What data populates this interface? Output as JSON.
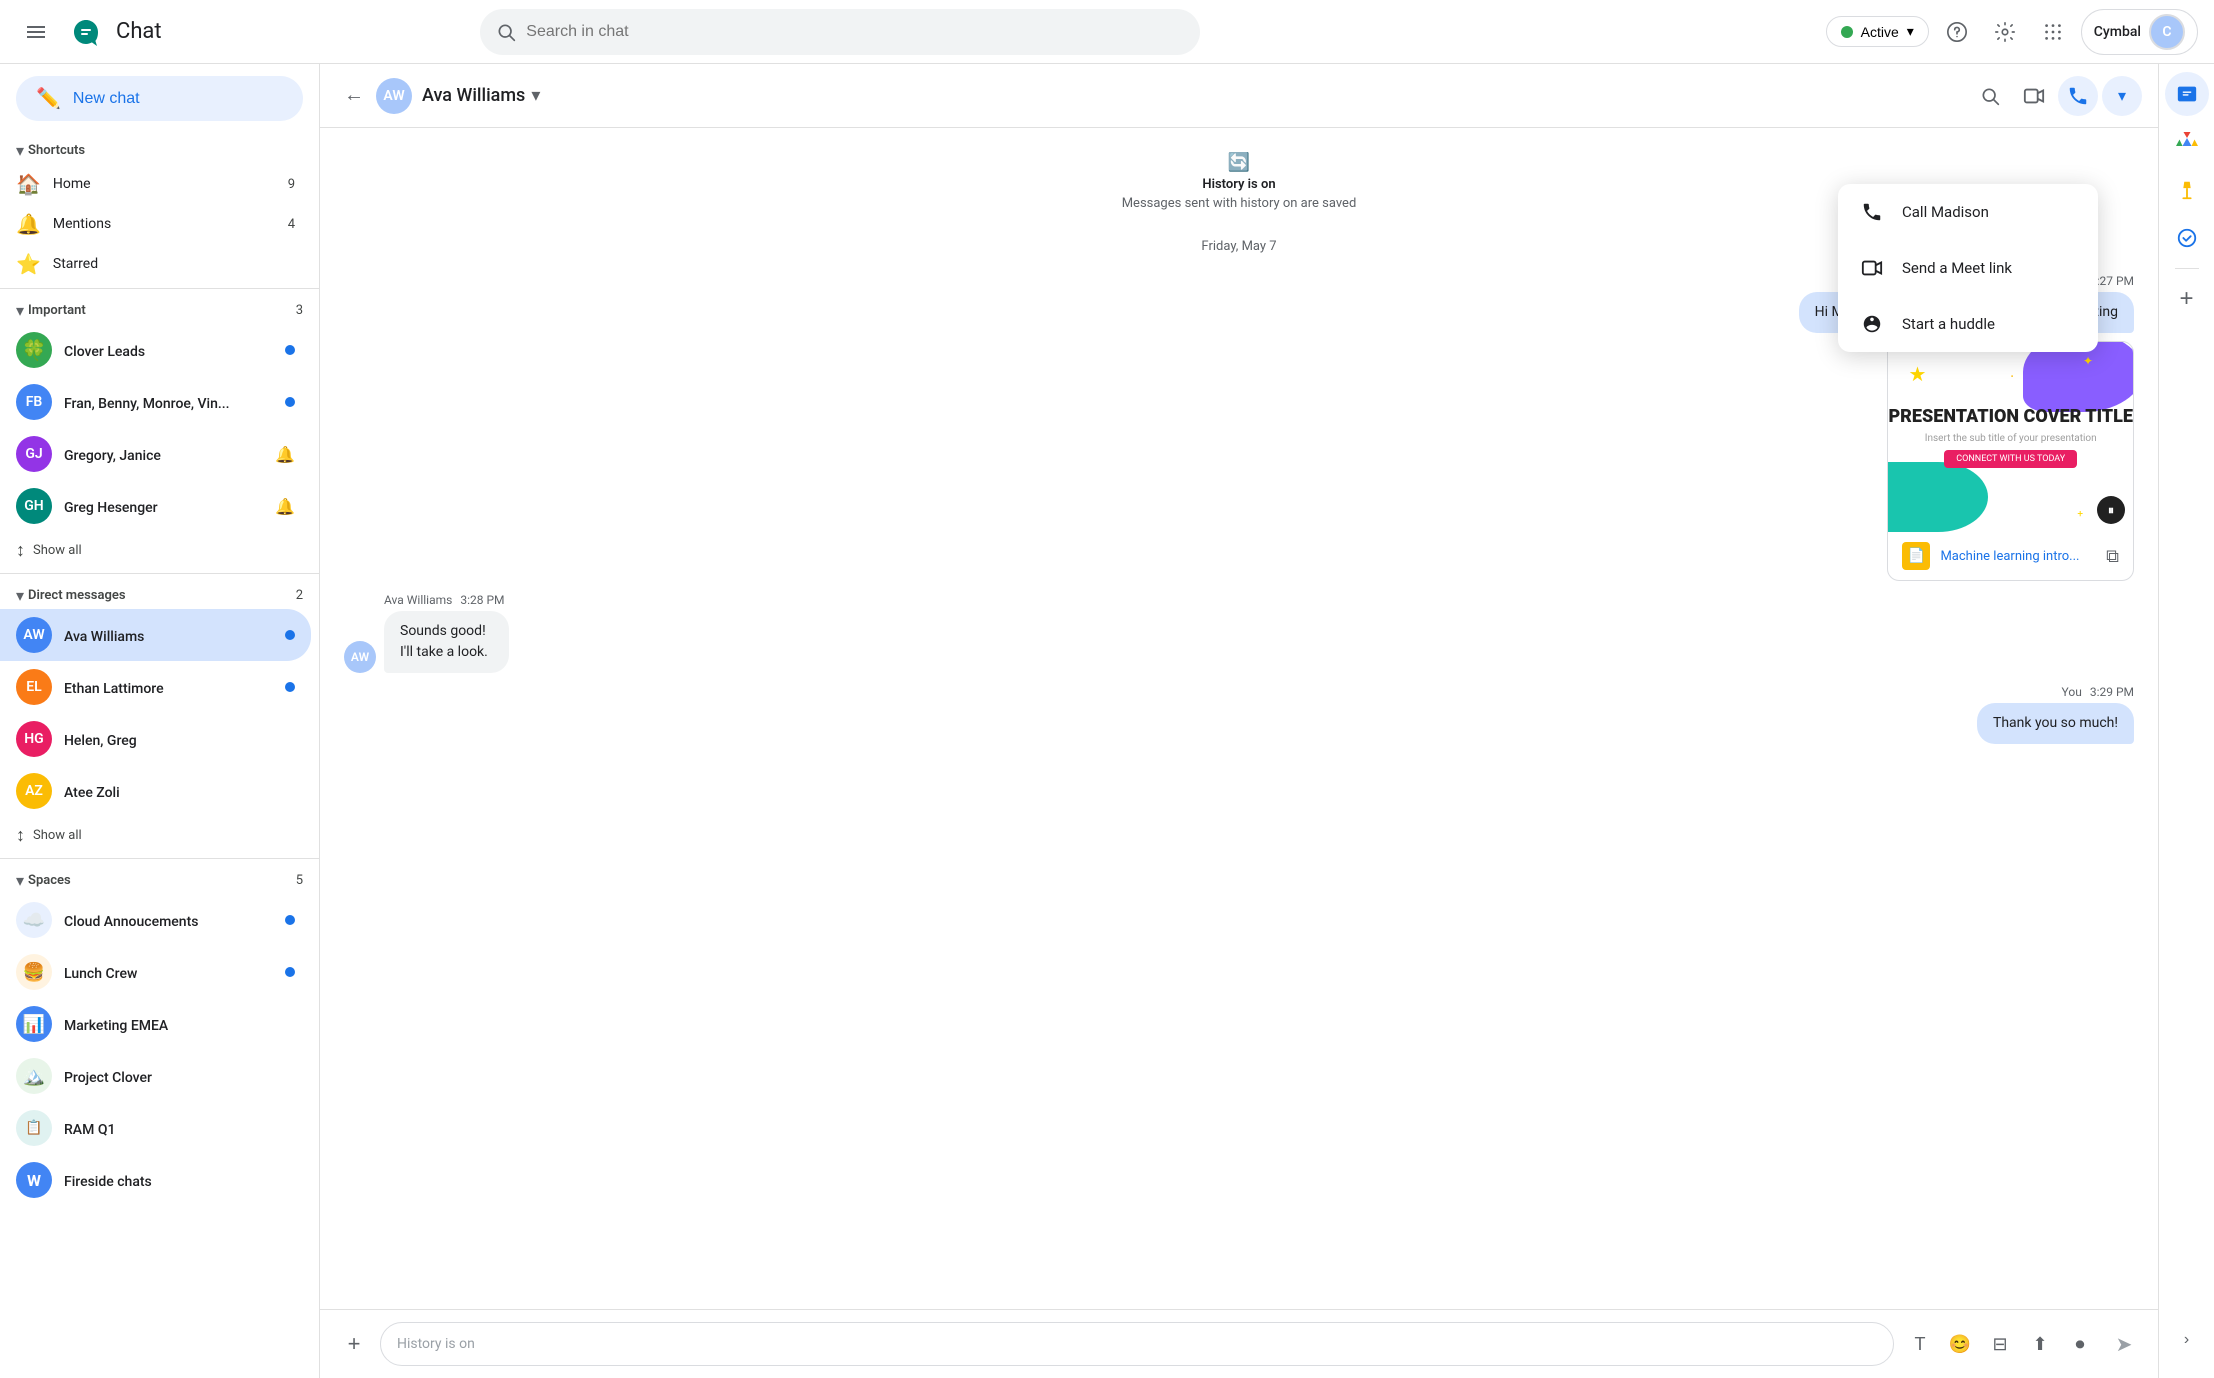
{
  "app": {
    "title": "Chat",
    "logo_alt": "Google Chat"
  },
  "topnav": {
    "search_placeholder": "Search in chat",
    "status": "Active",
    "account_name": "Cymbal",
    "help_label": "Help",
    "settings_label": "Settings",
    "apps_label": "Google apps"
  },
  "sidebar": {
    "new_chat_label": "New chat",
    "shortcuts": {
      "title": "Shortcuts",
      "items": [
        {
          "name": "Home",
          "count": "9",
          "icon": "🏠"
        },
        {
          "name": "Mentions",
          "count": "4",
          "icon": "🔔"
        },
        {
          "name": "Starred",
          "count": "",
          "icon": "⭐"
        }
      ]
    },
    "important": {
      "title": "Important",
      "count": "3",
      "items": [
        {
          "name": "Clover Leads",
          "has_badge": true,
          "avatar_color": "av-green",
          "initials": "🍀",
          "bell": false
        },
        {
          "name": "Fran, Benny, Monroe, Vin...",
          "has_badge": true,
          "avatar_color": "av-blue",
          "initials": "FB",
          "bell": false
        },
        {
          "name": "Gregory, Janice",
          "has_badge": false,
          "avatar_color": "av-purple",
          "initials": "GJ",
          "bell": true
        },
        {
          "name": "Greg Hesenger",
          "has_badge": false,
          "avatar_color": "av-teal",
          "initials": "GH",
          "bell": true
        }
      ],
      "show_all": "Show all"
    },
    "direct_messages": {
      "title": "Direct messages",
      "count": "2",
      "items": [
        {
          "name": "Ava Williams",
          "has_badge": true,
          "avatar_color": "av-blue",
          "initials": "AW",
          "active": true
        },
        {
          "name": "Ethan Lattimore",
          "has_badge": true,
          "avatar_color": "av-orange",
          "initials": "EL",
          "active": false
        },
        {
          "name": "Helen, Greg",
          "has_badge": false,
          "avatar_color": "av-pink",
          "initials": "HG",
          "active": false
        },
        {
          "name": "Atee Zoli",
          "has_badge": false,
          "avatar_color": "av-yellow",
          "initials": "AZ",
          "active": false
        }
      ],
      "show_all": "Show all"
    },
    "spaces": {
      "title": "Spaces",
      "count": "5",
      "items": [
        {
          "name": "Cloud Annoucements",
          "has_badge": true,
          "emoji": "☁️"
        },
        {
          "name": "Lunch Crew",
          "has_badge": true,
          "emoji": "🍔"
        },
        {
          "name": "Marketing EMEA",
          "has_badge": false,
          "emoji": "📊"
        },
        {
          "name": "Project Clover",
          "has_badge": false,
          "emoji": "🏔️"
        },
        {
          "name": "RAM Q1",
          "has_badge": false,
          "emoji": "📋"
        },
        {
          "name": "Fireside chats",
          "has_badge": false,
          "emoji": "W"
        }
      ]
    }
  },
  "chat": {
    "person_name": "Ava Williams",
    "history_notice": "History is on",
    "history_sub": "Messages sent with history on are saved",
    "date_divider": "Friday, May 7",
    "messages": [
      {
        "id": "m1",
        "sender": "You",
        "time": "3:27 PM",
        "text": "Hi Madision! Let's touch base before the meeting",
        "type": "outgoing",
        "has_attachment": true,
        "attachment": {
          "slide_title": "PRESENTATION COVER TITLE",
          "slide_subtitle": "Insert the sub title of your presentation",
          "doc_name": "Machine learning intro...",
          "cta": "CONNECT WITH US TODAY"
        }
      },
      {
        "id": "m2",
        "sender": "Ava Williams",
        "time": "3:28 PM",
        "text": "Sounds good! I'll take a look.",
        "type": "incoming"
      },
      {
        "id": "m3",
        "sender": "You",
        "time": "3:29 PM",
        "text": "Thank you so much!",
        "type": "outgoing"
      }
    ],
    "input_placeholder": "History is on"
  },
  "dropdown_menu": {
    "items": [
      {
        "id": "call",
        "label": "Call Madison",
        "icon": "📞"
      },
      {
        "id": "meet",
        "label": "Send a Meet link",
        "icon": "📹"
      },
      {
        "id": "huddle",
        "label": "Start a huddle",
        "icon": "🎧"
      }
    ]
  },
  "right_panel": {
    "icons": [
      {
        "id": "drive",
        "label": "Drive",
        "icon": "△",
        "color": "#34a853"
      },
      {
        "id": "keep",
        "label": "Keep",
        "icon": "◆",
        "color": "#fbbc04"
      },
      {
        "id": "tasks",
        "label": "Tasks",
        "icon": "✓",
        "color": "#1a73e8"
      }
    ]
  }
}
